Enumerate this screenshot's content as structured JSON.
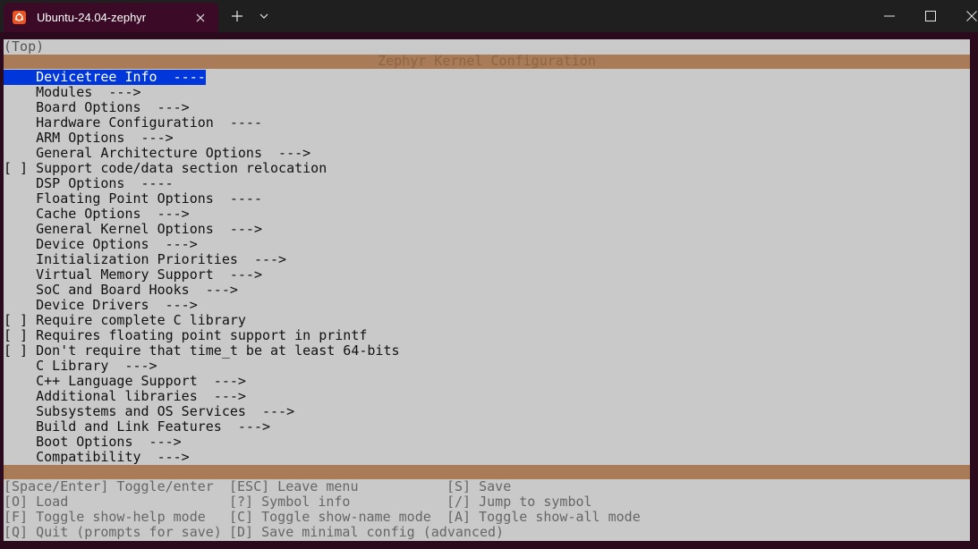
{
  "window": {
    "tab_title": "Ubuntu-24.04-zephyr",
    "icons": [
      "ubuntu-icon",
      "close-icon",
      "plus-icon",
      "chevron-down-icon",
      "minimize-icon",
      "maximize-icon",
      "window-close-icon"
    ]
  },
  "menuconfig": {
    "breadcrumb": "(Top)",
    "title": "Zephyr Kernel Configuration",
    "items": [
      {
        "prefix": "    ",
        "label": "Devicetree Info",
        "suffix": "  ----"
      },
      {
        "prefix": "    ",
        "label": "Modules",
        "suffix": "  --->"
      },
      {
        "prefix": "    ",
        "label": "Board Options",
        "suffix": "  --->"
      },
      {
        "prefix": "    ",
        "label": "Hardware Configuration",
        "suffix": "  ----"
      },
      {
        "prefix": "    ",
        "label": "ARM Options",
        "suffix": "  --->"
      },
      {
        "prefix": "    ",
        "label": "General Architecture Options",
        "suffix": "  --->"
      },
      {
        "prefix": "[ ] ",
        "label": "Support code/data section relocation",
        "suffix": ""
      },
      {
        "prefix": "    ",
        "label": "DSP Options",
        "suffix": "  ----"
      },
      {
        "prefix": "    ",
        "label": "Floating Point Options",
        "suffix": "  ----"
      },
      {
        "prefix": "    ",
        "label": "Cache Options",
        "suffix": "  --->"
      },
      {
        "prefix": "    ",
        "label": "General Kernel Options",
        "suffix": "  --->"
      },
      {
        "prefix": "    ",
        "label": "Device Options",
        "suffix": "  --->"
      },
      {
        "prefix": "    ",
        "label": "Initialization Priorities",
        "suffix": "  --->"
      },
      {
        "prefix": "    ",
        "label": "Virtual Memory Support",
        "suffix": "  --->"
      },
      {
        "prefix": "    ",
        "label": "SoC and Board Hooks",
        "suffix": "  --->"
      },
      {
        "prefix": "    ",
        "label": "Device Drivers",
        "suffix": "  --->"
      },
      {
        "prefix": "[ ] ",
        "label": "Require complete C library",
        "suffix": ""
      },
      {
        "prefix": "[ ] ",
        "label": "Requires floating point support in printf",
        "suffix": ""
      },
      {
        "prefix": "[ ] ",
        "label": "Don't require that time_t be at least 64-bits",
        "suffix": ""
      },
      {
        "prefix": "    ",
        "label": "C Library",
        "suffix": "  --->"
      },
      {
        "prefix": "    ",
        "label": "C++ Language Support",
        "suffix": "  --->"
      },
      {
        "prefix": "    ",
        "label": "Additional libraries",
        "suffix": "  --->"
      },
      {
        "prefix": "    ",
        "label": "Subsystems and OS Services",
        "suffix": "  --->"
      },
      {
        "prefix": "    ",
        "label": "Build and Link Features",
        "suffix": "  --->"
      },
      {
        "prefix": "    ",
        "label": "Boot Options",
        "suffix": "  --->"
      },
      {
        "prefix": "    ",
        "label": "Compatibility",
        "suffix": "  --->"
      }
    ],
    "selected_index": 0,
    "help": [
      [
        "[Space/Enter] Toggle/enter",
        "[ESC] Leave menu",
        "[S] Save"
      ],
      [
        "[O] Load",
        "[?] Symbol info",
        "[/] Jump to symbol"
      ],
      [
        "[F] Toggle show-help mode",
        "[C] Toggle show-name mode",
        "[A] Toggle show-all mode"
      ],
      [
        "[Q] Quit (prompts for save)",
        "[D] Save minimal config (advanced)",
        ""
      ]
    ]
  },
  "colors": {
    "selection": "#0037da",
    "title_bar": "#a97b56",
    "terminal_bg": "#c9c9c9",
    "ubuntu_orange": "#e95420"
  }
}
